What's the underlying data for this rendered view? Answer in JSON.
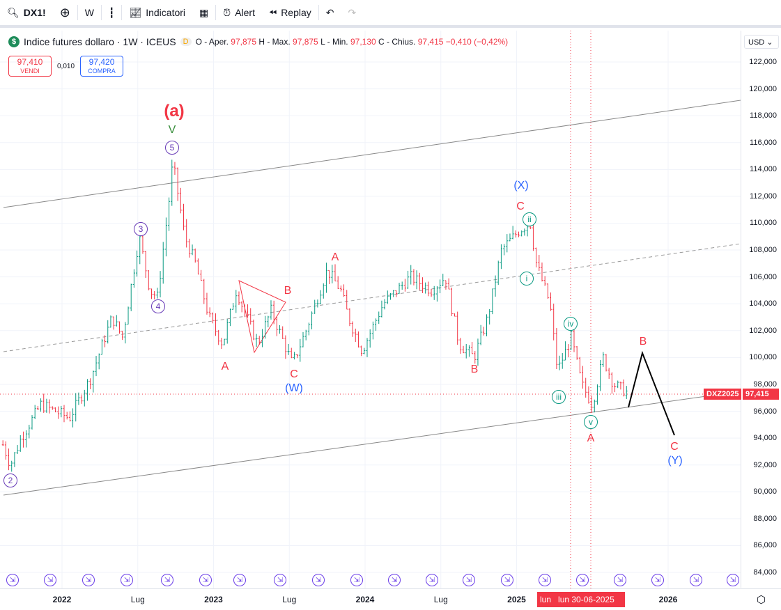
{
  "toolbar": {
    "symbol": "DX1!",
    "interval": "W",
    "indicators": "Indicatori",
    "alert": "Alert",
    "replay": "Replay"
  },
  "legend": {
    "title": "Indice futures dollaro · 1W · ICEUS",
    "logo": "$",
    "d_badge": "D",
    "o_label": "O - Aper.",
    "o": "97,875",
    "h_label": "H - Max.",
    "h": "97,875",
    "l_label": "L - Min.",
    "l": "97,130",
    "c_label": "C - Chius.",
    "c": "97,415",
    "change": "−0,410 (−0,42%)"
  },
  "trade": {
    "sell_price": "97,410",
    "sell_label": "VENDI",
    "spread": "0,010",
    "buy_price": "97,420",
    "buy_label": "COMPRA"
  },
  "currency": "USD",
  "price_tag": {
    "symbol": "DXZ2025",
    "price": "97,415"
  },
  "time_cursor": {
    "a": "lun",
    "b": "lun 30-06-2025"
  },
  "colors": {
    "up": "#089981",
    "down": "#f23645",
    "accent": "#2962ff"
  },
  "chart_data": {
    "type": "candlestick",
    "title": "Indice futures dollaro · 1W · ICEUS",
    "ylim": [
      83000,
      123000
    ],
    "y_ticks": [
      "122,000",
      "120,000",
      "118,000",
      "116,000",
      "114,000",
      "112,000",
      "110,000",
      "108,000",
      "106,000",
      "104,000",
      "102,000",
      "100,000",
      "98,000",
      "96,000",
      "94,000",
      "92,000",
      "90,000",
      "88,000",
      "86,000",
      "84,000"
    ],
    "x_ticks": [
      {
        "label": "2022",
        "t": 2022,
        "major": true
      },
      {
        "label": "Lug",
        "t": 2022.5
      },
      {
        "label": "2023",
        "t": 2023,
        "major": true
      },
      {
        "label": "Lug",
        "t": 2023.5
      },
      {
        "label": "2024",
        "t": 2024,
        "major": true
      },
      {
        "label": "Lug",
        "t": 2024.5
      },
      {
        "label": "2025",
        "t": 2025,
        "major": true
      },
      {
        "label": "2026",
        "t": 2026,
        "major": true
      }
    ],
    "price_path": [
      [
        2021.61,
        93.5
      ],
      [
        2021.66,
        92
      ],
      [
        2021.73,
        94
      ],
      [
        2021.86,
        96.5
      ],
      [
        2022.05,
        95.5
      ],
      [
        2022.19,
        98.5
      ],
      [
        2022.33,
        103
      ],
      [
        2022.4,
        101.5
      ],
      [
        2022.51,
        109
      ],
      [
        2022.58,
        105
      ],
      [
        2022.63,
        104.5
      ],
      [
        2022.72,
        113
      ],
      [
        2022.73,
        114.7
      ],
      [
        2022.81,
        109
      ],
      [
        2022.88,
        107
      ],
      [
        2022.97,
        103
      ],
      [
        2023.06,
        101
      ],
      [
        2023.15,
        105
      ],
      [
        2023.29,
        101
      ],
      [
        2023.38,
        103.5
      ],
      [
        2023.52,
        99.5
      ],
      [
        2023.61,
        102
      ],
      [
        2023.75,
        106.5
      ],
      [
        2023.84,
        105
      ],
      [
        2023.89,
        103
      ],
      [
        2023.98,
        100.5
      ],
      [
        2024.12,
        104
      ],
      [
        2024.3,
        106
      ],
      [
        2024.44,
        105
      ],
      [
        2024.53,
        106
      ],
      [
        2024.62,
        101
      ],
      [
        2024.72,
        100
      ],
      [
        2024.81,
        103
      ],
      [
        2024.9,
        108
      ],
      [
        2025.02,
        109.5
      ],
      [
        2025.09,
        110
      ],
      [
        2025.13,
        107
      ],
      [
        2025.22,
        104
      ],
      [
        2025.27,
        99
      ],
      [
        2025.36,
        101.5
      ],
      [
        2025.43,
        98
      ],
      [
        2025.5,
        96.5
      ],
      [
        2025.57,
        100
      ],
      [
        2025.64,
        98
      ],
      [
        2025.73,
        97.4
      ]
    ],
    "wave_labels": [
      "(a)",
      "V",
      "5",
      "3",
      "4",
      "2",
      "A",
      "B",
      "C",
      "(W)",
      "A",
      "B",
      "(X)",
      "C",
      "ii",
      "i",
      "iv",
      "iii",
      "v",
      "A",
      "B",
      "C",
      "(Y)"
    ]
  }
}
